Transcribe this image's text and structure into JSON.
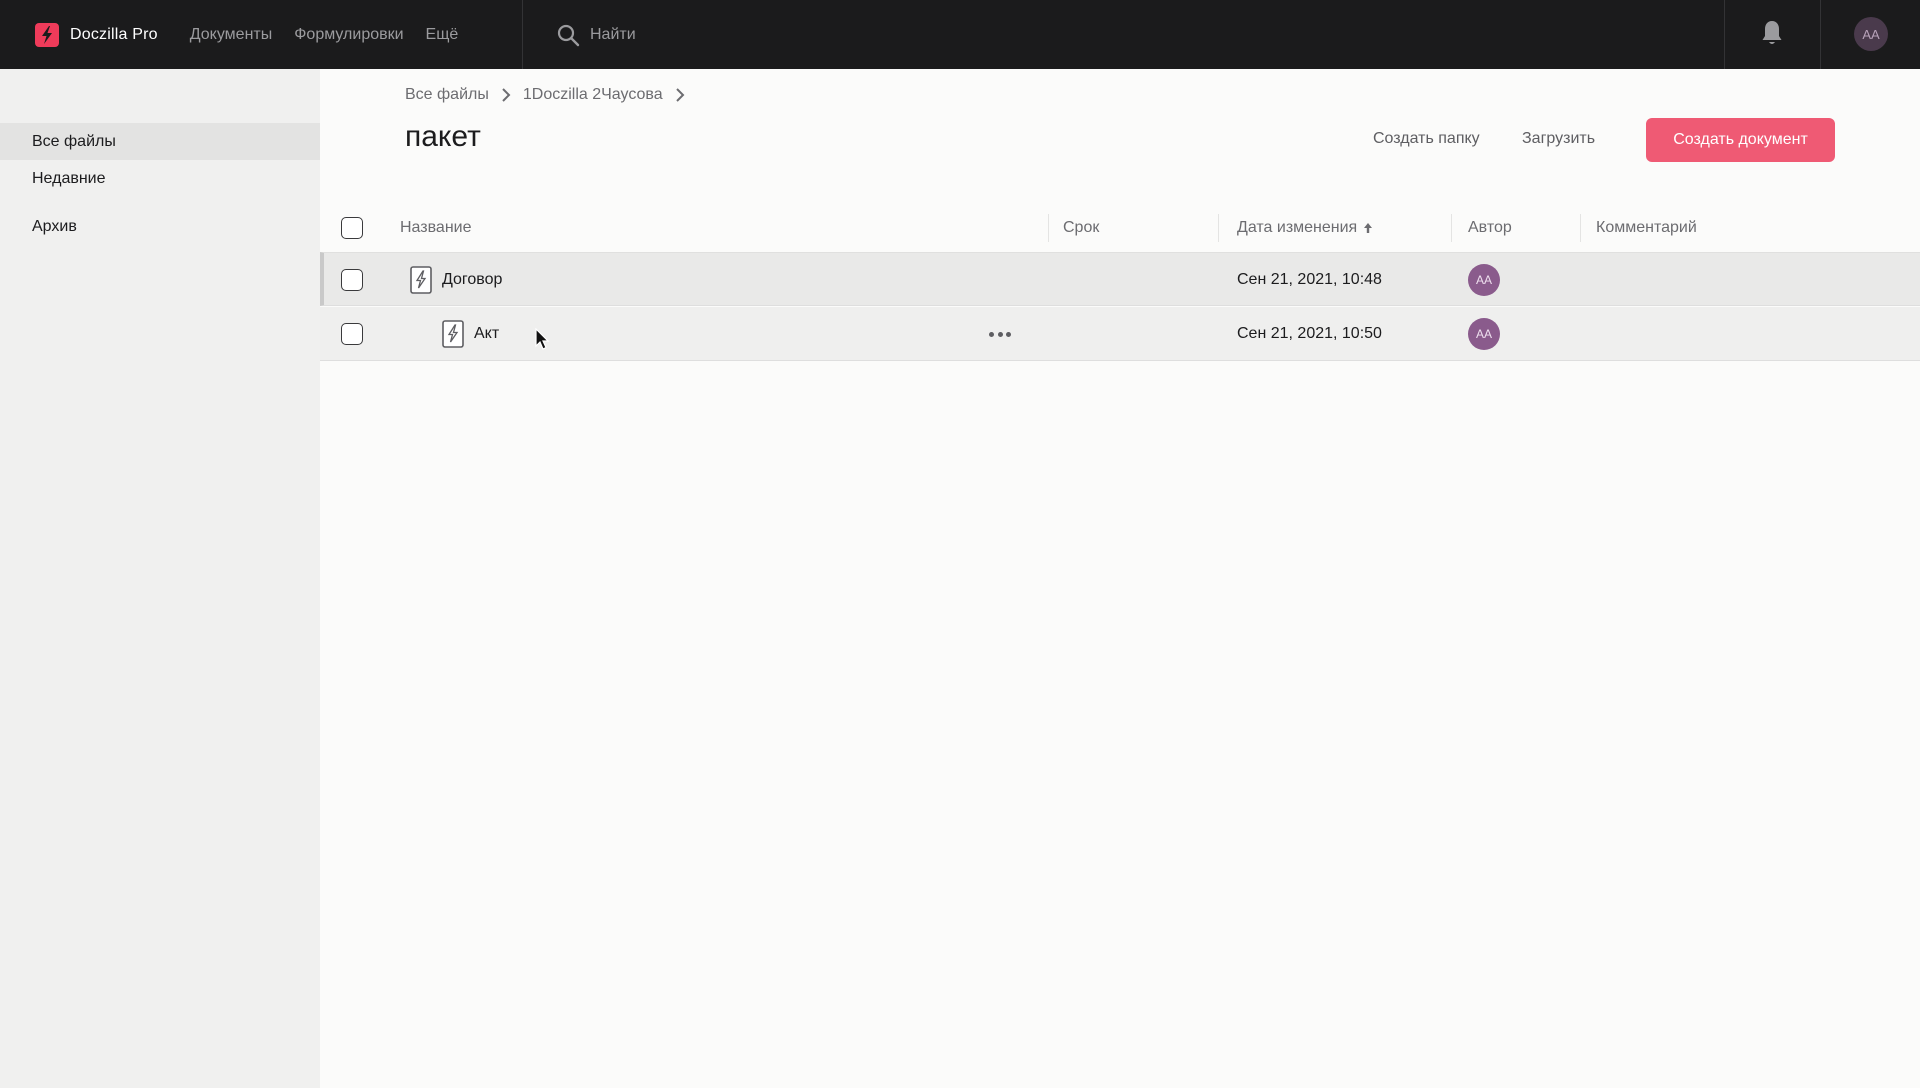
{
  "topbar": {
    "brand_name": "Doczilla Pro",
    "nav": [
      "Документы",
      "Формулировки",
      "Ещё"
    ],
    "search_label": "Найти",
    "user_initials": "AA"
  },
  "sidebar": {
    "items": [
      {
        "label": "Все файлы",
        "active": true
      },
      {
        "label": "Недавние",
        "active": false
      },
      {
        "label": "Архив",
        "active": false
      }
    ]
  },
  "breadcrumb": [
    "Все файлы",
    "1Doczilla 2Чаусова"
  ],
  "page_title": "пакет",
  "actions": {
    "create_folder": "Создать папку",
    "upload": "Загрузить",
    "create_document": "Создать документ"
  },
  "table": {
    "columns": {
      "name": "Название",
      "deadline": "Срок",
      "modified": "Дата изменения",
      "author": "Автор",
      "comment": "Комментарий"
    },
    "rows": [
      {
        "name": "Договор",
        "deadline": "",
        "modified": "Сен 21, 2021, 10:48",
        "author": "AA",
        "comment": ""
      },
      {
        "name": "Акт",
        "deadline": "",
        "modified": "Сен 21, 2021, 10:50",
        "author": "AA",
        "comment": ""
      }
    ]
  },
  "colors": {
    "accent": "#ef5a74",
    "topbar": "#1b1b1c",
    "avatar": "#8a5b8c"
  }
}
